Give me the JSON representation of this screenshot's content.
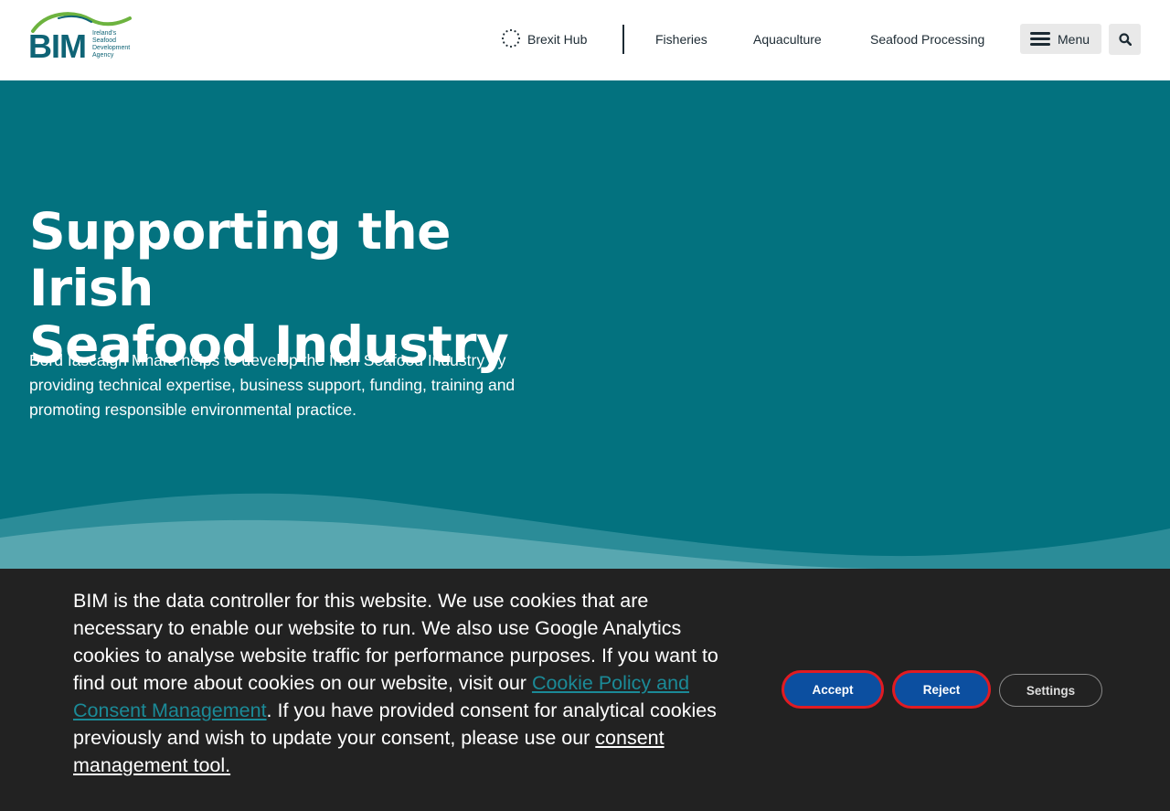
{
  "header": {
    "logo": {
      "wordmark": "BIM",
      "tagline": [
        "Ireland's",
        "Seafood",
        "Development",
        "Agency"
      ]
    },
    "nav": {
      "brexit_hub": "Brexit Hub",
      "fisheries": "Fisheries",
      "aquaculture": "Aquaculture",
      "seafood_processing": "Seafood Processing"
    },
    "menu_label": "Menu",
    "search_icon": "search-icon"
  },
  "hero": {
    "title_line1": "Supporting the Irish",
    "title_line2": "Seafood Industry",
    "description": "Bord Iascaigh Mhara helps to develop the Irish Seafood Industry by providing technical expertise, business support, funding, training and promoting responsible environmental practice."
  },
  "cookie_banner": {
    "text_part1": "BIM is the data controller for this website. We use cookies that are necessary to enable our website to run. We also use Google Analytics cookies to analyse website traffic for performance purposes. If you want to find out more about cookies on our website, visit our ",
    "policy_link": "Cookie Policy and Consent Management",
    "text_part2": ". If you have provided consent for analytical cookies previously and wish to update your consent, please use our ",
    "tool_link": "consent management tool.",
    "accept_label": "Accept",
    "reject_label": "Reject",
    "settings_label": "Settings"
  },
  "colors": {
    "hero_bg": "#03727f",
    "banner_bg": "#222222",
    "button_blue": "#0c4fa0",
    "focus_red": "#e01b22",
    "logo_green": "#6db33f",
    "logo_teal": "#0f6476"
  }
}
